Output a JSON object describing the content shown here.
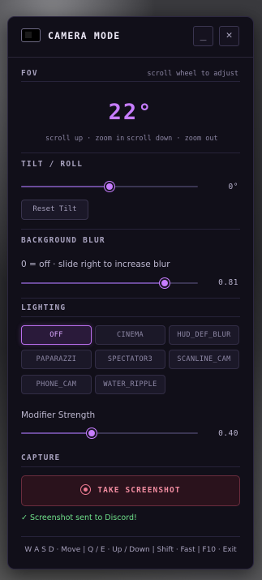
{
  "title": "CAMERA MODE",
  "window_buttons": {
    "minimize": "_",
    "close": "✕"
  },
  "fov": {
    "label": "FOV",
    "hint": "scroll wheel to adjust",
    "value": "22°",
    "scroll_up_hint": "scroll up · zoom in",
    "scroll_down_hint": "scroll down · zoom out"
  },
  "tilt": {
    "label": "TILT / ROLL",
    "value": "0°",
    "level": 0.5,
    "reset_label": "Reset Tilt"
  },
  "blur": {
    "label": "BACKGROUND BLUR",
    "description": "0 = off · slide right to increase blur",
    "value": "0.81",
    "level": 0.81
  },
  "lighting": {
    "label": "LIGHTING",
    "options": [
      "OFF",
      "CINEMA",
      "HUD_DEF_BLUR",
      "PAPARAZZI",
      "SPECTATOR3",
      "SCANLINE_CAM",
      "PHONE_CAM",
      "WATER_RIPPLE"
    ],
    "selected": "OFF",
    "modifier_label": "Modifier Strength",
    "modifier_value": "0.40",
    "modifier_level": 0.4
  },
  "capture": {
    "label": "CAPTURE",
    "button_label": "TAKE SCREENSHOT",
    "status": "✓ Screenshot sent to Discord!"
  },
  "footer": "W A S D · Move  |  Q / E · Up / Down  |  Shift · Fast  |  F10 · Exit",
  "colors": {
    "accent": "#c77dff",
    "capture": "#ee7b93",
    "success": "#6fe08a"
  }
}
